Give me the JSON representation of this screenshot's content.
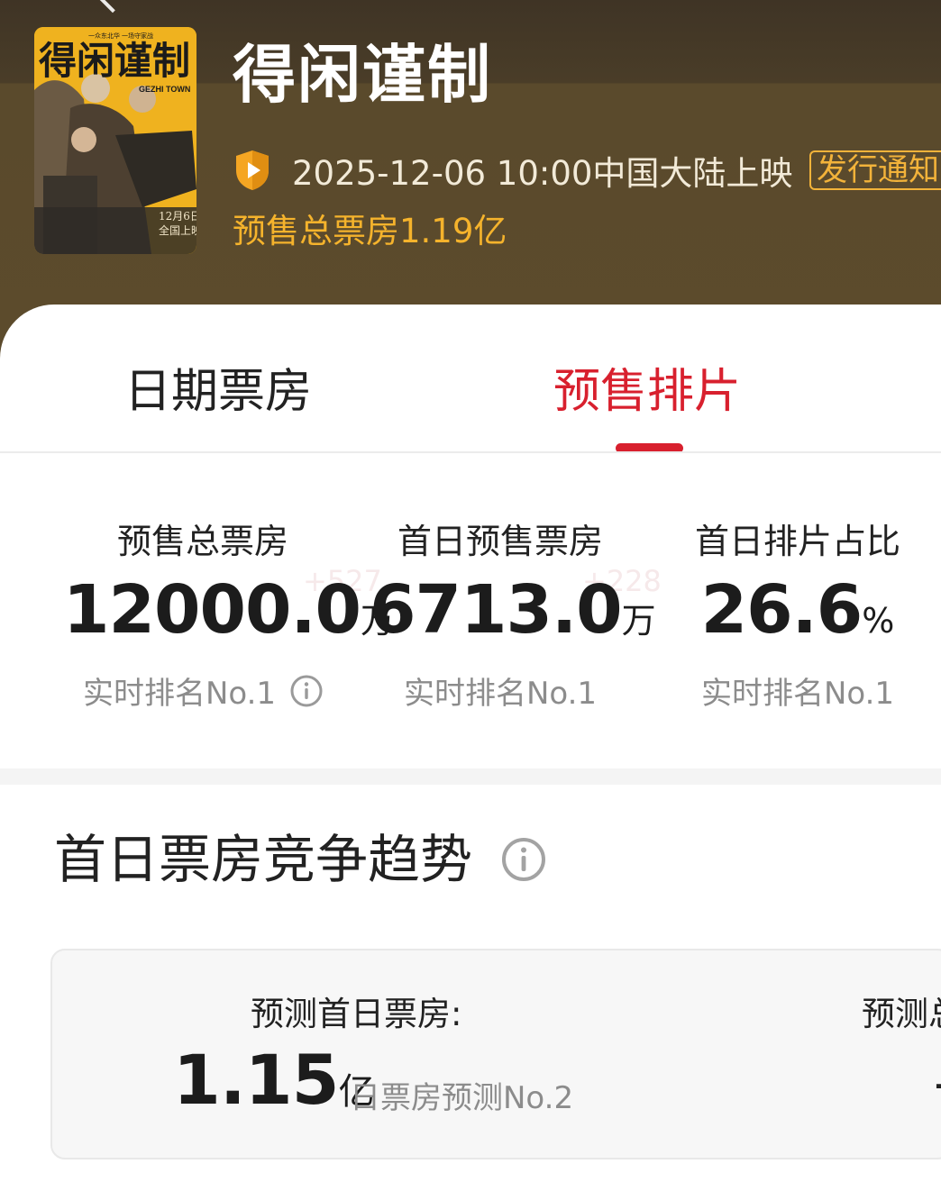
{
  "header": {
    "title": "得闲谨制",
    "poster": {
      "title_art": "得闲谨制",
      "subtitle": "GEZHI TOWN",
      "tagline": "一众东北华 一场守家战",
      "release_note_line1": "12月6日",
      "release_note_line2": "全国上映"
    },
    "release_text": "2025-12-06 10:00中国大陆上映",
    "notify_button": "发行通知",
    "presale_total": "预售总票房1.19亿",
    "colors": {
      "accent": "#f5b32c",
      "header_bg": "#5c4b2c"
    }
  },
  "tabs": [
    {
      "label": "日期票房",
      "active": false
    },
    {
      "label": "预售排片",
      "active": true
    }
  ],
  "stats": [
    {
      "label": "预售总票房",
      "value": "12000.0",
      "unit": "万",
      "rank": "实时排名No.1"
    },
    {
      "label": "首日预售票房",
      "value": "6713.0",
      "unit": "万",
      "rank": "实时排名No.1"
    },
    {
      "label": "首日排片占比",
      "value": "26.6",
      "unit": "%",
      "rank": "实时排名No.1"
    }
  ],
  "stat_ghosts": [
    "+527",
    "+228"
  ],
  "trend": {
    "title": "首日票房竞争趋势",
    "forecast_label": "预测首日票房:",
    "forecast_value": "1.15",
    "forecast_unit": "亿",
    "forecast_rank": "日票房预测No.2",
    "forecast_label_2": "预测总",
    "forecast_value_2": "-"
  },
  "icons": [
    "back-chevron-icon",
    "shield-play-icon",
    "info-icon"
  ],
  "theme": {
    "active_tab": "#d8202e"
  }
}
